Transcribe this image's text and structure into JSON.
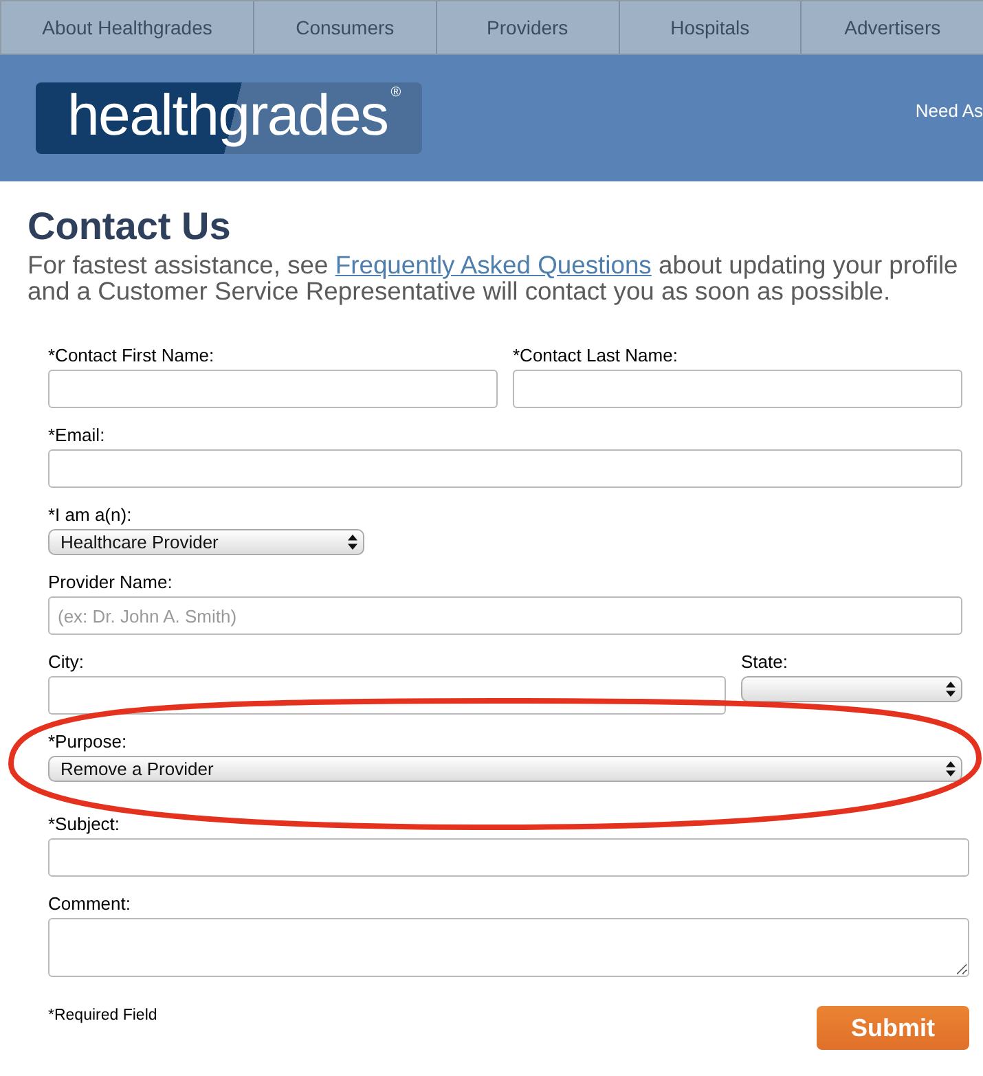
{
  "nav": {
    "tabs": [
      {
        "label": "About Healthgrades"
      },
      {
        "label": "Consumers"
      },
      {
        "label": "Providers"
      },
      {
        "label": "Hospitals"
      },
      {
        "label": "Advertisers"
      }
    ]
  },
  "header": {
    "logo": "healthgrades$^{®}$",
    "help_text": "Need As"
  },
  "page": {
    "title": "Contact Us",
    "intro": {
      "before": "For fastest assistance, see",
      "link": "Frequently Asked Questions",
      "after": "about updating your profile",
      "line_2": "and a Customer Service Representative will contact you as soon as possible."
    }
  },
  "form": {
    "rows": [
      [
        {
          "label": "*Contact First Name:",
          "kind": "text"
        },
        {
          "label": "*Contact Last Name:",
          "kind": "text"
        }
      ],
      [
        {
          "label": "*Email:",
          "kind": "text"
        }
      ],
      [
        {
          "label": "*I am a(n):",
          "kind": "select",
          "value": "Healthcare Provider"
        }
      ],
      [
        {
          "label": "Provider Name:",
          "kind": "text",
          "placeholder": "(ex: Dr. John A. Smith)"
        }
      ],
      [
        {
          "label": "City:",
          "kind": "text"
        },
        {
          "label": "State:",
          "kind": "select"
        }
      ],
      [
        {
          "label": "*Purpose:",
          "kind": "select",
          "value": "Remove a Provider",
          "annotation": {
            "kind": "ellipse"
          }
        }
      ],
      [
        {
          "label": "*Subject:",
          "kind": "text"
        }
      ],
      [
        {
          "label": "Comment:",
          "kind": "textarea"
        }
      ]
    ],
    "note": "*Required Field",
    "submit": "Submit"
  }
}
